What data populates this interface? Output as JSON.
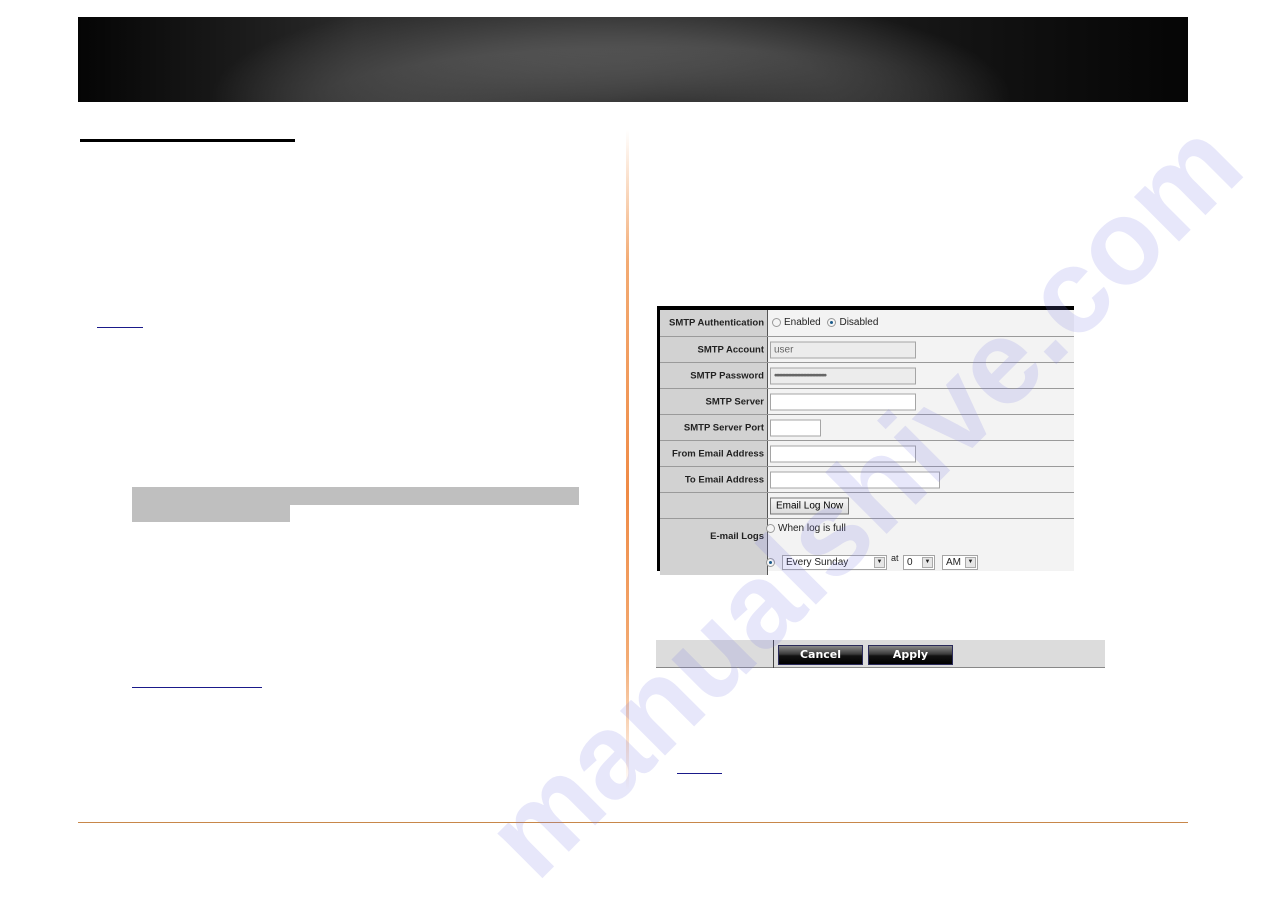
{
  "page": {
    "watermark": "manualshive.com",
    "accent_color": "#ef8a45",
    "footer_rule_color": "#c8874a",
    "link_color": "#1a1a8a"
  },
  "email_settings_form": {
    "rows": [
      {
        "label": "SMTP Authentication",
        "type": "radio",
        "options": [
          {
            "label": "Enabled",
            "checked": false
          },
          {
            "label": "Disabled",
            "checked": true
          }
        ]
      },
      {
        "label": "SMTP Account",
        "type": "text",
        "value": "user",
        "disabled": true
      },
      {
        "label": "SMTP Password",
        "type": "password",
        "value": "••••••••••••••••••••••••••••••••••",
        "disabled": true
      },
      {
        "label": "SMTP Server",
        "type": "text",
        "value": ""
      },
      {
        "label": "SMTP Server Port",
        "type": "text",
        "value": ""
      },
      {
        "label": "From Email Address",
        "type": "text",
        "value": ""
      },
      {
        "label": "To Email Address",
        "type": "text",
        "value": ""
      },
      {
        "label": "",
        "type": "button",
        "button_label": "Email Log Now"
      },
      {
        "label": "E-mail Logs",
        "type": "schedule",
        "option_full": {
          "label": "When log is full",
          "checked": false
        },
        "option_schedule": {
          "checked": true,
          "day": "Every Sunday",
          "at_label": "at",
          "hour": "0",
          "ampm": "AM"
        }
      }
    ]
  },
  "actions": {
    "cancel_label": "Cancel",
    "apply_label": "Apply"
  }
}
